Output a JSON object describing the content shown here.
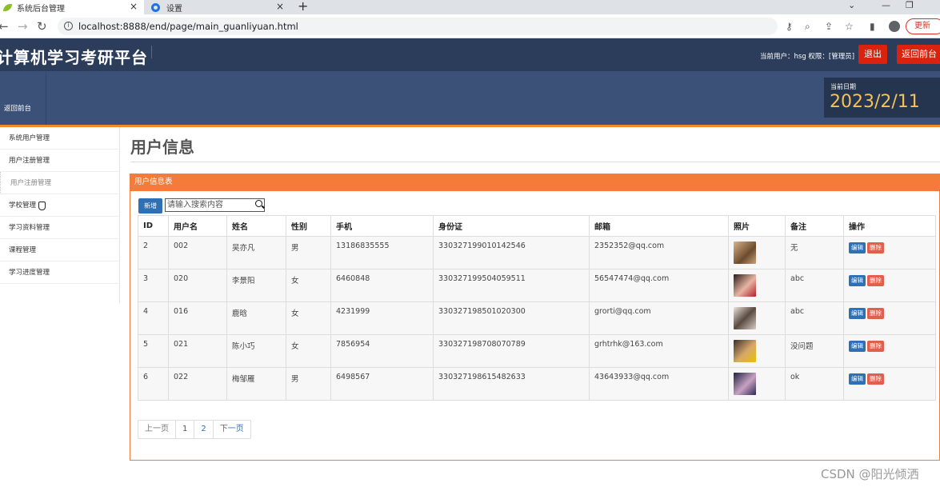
{
  "browser": {
    "tabs": [
      {
        "title": "系统后台管理",
        "icon": "leaf-icon",
        "active": true
      },
      {
        "title": "设置",
        "icon": "gear-icon",
        "active": false
      }
    ],
    "url": "localhost:8888/end/page/main_guanliyuan.html",
    "update_label": "更新"
  },
  "header": {
    "title": "计算机学习考研平台",
    "user_info": "当前用户：hsg  权限：[管理员]",
    "logout_label": "退出",
    "back_front_label": "返回前台"
  },
  "subbar": {
    "back_label": "返回前台",
    "date_label": "当前日期",
    "date_value": "2023/2/11"
  },
  "sidebar": {
    "items": [
      {
        "label": "系统用户管理"
      },
      {
        "label": "用户注册管理"
      },
      {
        "label": "用户注册管理"
      },
      {
        "label": "学校管理"
      },
      {
        "label": "学习资料管理"
      },
      {
        "label": "课程管理"
      },
      {
        "label": "学习进度管理"
      }
    ]
  },
  "main": {
    "page_title": "用户信息",
    "panel_title": "用户信息表",
    "add_label": "新增",
    "search_placeholder": "请输入搜索内容",
    "columns": [
      "ID",
      "用户名",
      "姓名",
      "性别",
      "手机",
      "身份证",
      "邮箱",
      "照片",
      "备注",
      "操作"
    ],
    "rows": [
      {
        "id": "2",
        "username": "002",
        "name": "吴亦凡",
        "gender": "男",
        "phone": "13186835555",
        "idcard": "330327199010142546",
        "email": "2352352@qq.com",
        "note": "无"
      },
      {
        "id": "3",
        "username": "020",
        "name": "李景阳",
        "gender": "女",
        "phone": "6460848",
        "idcard": "330327199504059511",
        "email": "56547474@qq.com",
        "note": "abc"
      },
      {
        "id": "4",
        "username": "016",
        "name": "鹿晗",
        "gender": "女",
        "phone": "4231999",
        "idcard": "330327198501020300",
        "email": "grorti@qq.com",
        "note": "abc"
      },
      {
        "id": "5",
        "username": "021",
        "name": "陈小巧",
        "gender": "女",
        "phone": "7856954",
        "idcard": "330327198708070789",
        "email": "grhtrhk@163.com",
        "note": "没问题"
      },
      {
        "id": "6",
        "username": "022",
        "name": "梅邹雁",
        "gender": "男",
        "phone": "6498567",
        "idcard": "330327198615482633",
        "email": "43643933@qq.com",
        "note": "ok"
      }
    ],
    "edit_label": "编辑",
    "delete_label": "删除",
    "pager": {
      "prev": "上一页",
      "pages": [
        "1",
        "2"
      ],
      "next": "下一页"
    }
  },
  "watermark": "CSDN @阳光倾洒",
  "colors": {
    "header": "#2b3d5a",
    "accent": "#f47b3a",
    "danger": "#d9230f",
    "primary": "#2f6fb3",
    "date": "#f4c25a"
  }
}
